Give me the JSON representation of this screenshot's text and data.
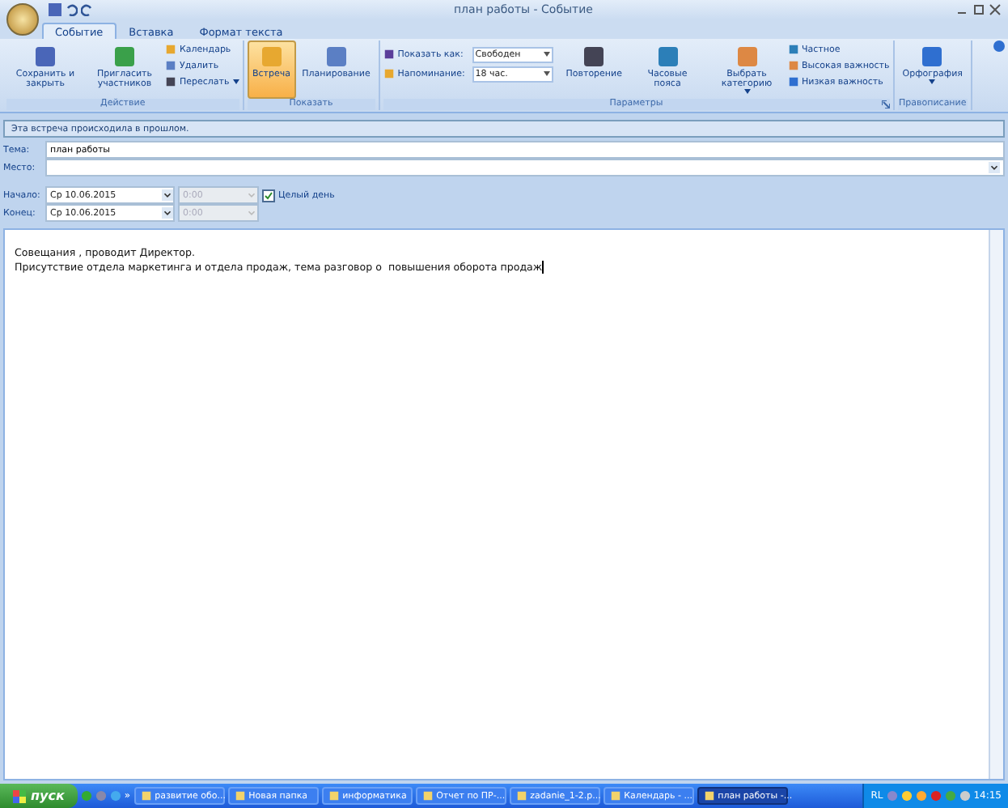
{
  "window": {
    "title": "план работы - Событие"
  },
  "tabs": [
    {
      "label": "Событие",
      "selected": true
    },
    {
      "label": "Вставка",
      "selected": false
    },
    {
      "label": "Формат текста",
      "selected": false
    }
  ],
  "ribbon_groups": [
    {
      "label": "Действие",
      "items": [
        {
          "kind": "large",
          "label": "Сохранить и закрыть"
        },
        {
          "kind": "large",
          "label": "Пригласить участников"
        },
        {
          "kind": "stack",
          "buttons": [
            {
              "label": "Календарь"
            },
            {
              "label": "Удалить"
            },
            {
              "label": "Переслать",
              "dropdown": true
            }
          ]
        }
      ]
    },
    {
      "label": "Показать",
      "items": [
        {
          "kind": "large",
          "label": "Встреча",
          "selected": true
        },
        {
          "kind": "large",
          "label": "Планирование",
          "selected": false
        }
      ]
    },
    {
      "label": "Параметры",
      "launcher": true,
      "items": [
        {
          "kind": "fields",
          "fields": [
            {
              "label": "Показать как:",
              "value": "Свободен"
            },
            {
              "label": "Напоминание:",
              "value": "18 час."
            }
          ]
        },
        {
          "kind": "large",
          "label": "Повторение"
        },
        {
          "kind": "large",
          "label": "Часовые пояса"
        },
        {
          "kind": "large",
          "label": "Выбрать категорию",
          "dropdown": true
        },
        {
          "kind": "stack",
          "buttons": [
            {
              "label": "Частное"
            },
            {
              "label": "Высокая важность"
            },
            {
              "label": "Низкая важность"
            }
          ]
        }
      ]
    },
    {
      "label": "Правописание",
      "items": [
        {
          "kind": "large",
          "label": "Орфография",
          "dropdown": true
        }
      ]
    }
  ],
  "info_bar": "Эта встреча происходила в прошлом.",
  "subject": {
    "label": "Тема:",
    "value": "план работы"
  },
  "location": {
    "label": "Место:"
  },
  "start": {
    "label": "Начало:",
    "date": "Ср 10.06.2015",
    "time": "0:00"
  },
  "end": {
    "label": "Конец:",
    "date": "Ср 10.06.2015",
    "time": "0:00"
  },
  "all_day": {
    "label": "Целый день",
    "checked": true
  },
  "body": [
    "Совещания , проводит Директор.",
    "Присутствие отдела маркетинга и отдела продаж, тема разговор о  повышения оборота продаж"
  ],
  "taskbar": {
    "start": "пуск",
    "more": "»",
    "tasks": [
      {
        "label": "развитие обо...",
        "selected": false
      },
      {
        "label": "Новая папка",
        "selected": false
      },
      {
        "label": "информатика",
        "selected": false
      },
      {
        "label": "Отчет по ПР-...",
        "selected": false
      },
      {
        "label": "zadanie_1-2.p...",
        "selected": false
      },
      {
        "label": "Календарь - ...",
        "selected": false
      },
      {
        "label": "план работы -...",
        "selected": true
      }
    ],
    "language": "RL",
    "clock": "14:15"
  }
}
